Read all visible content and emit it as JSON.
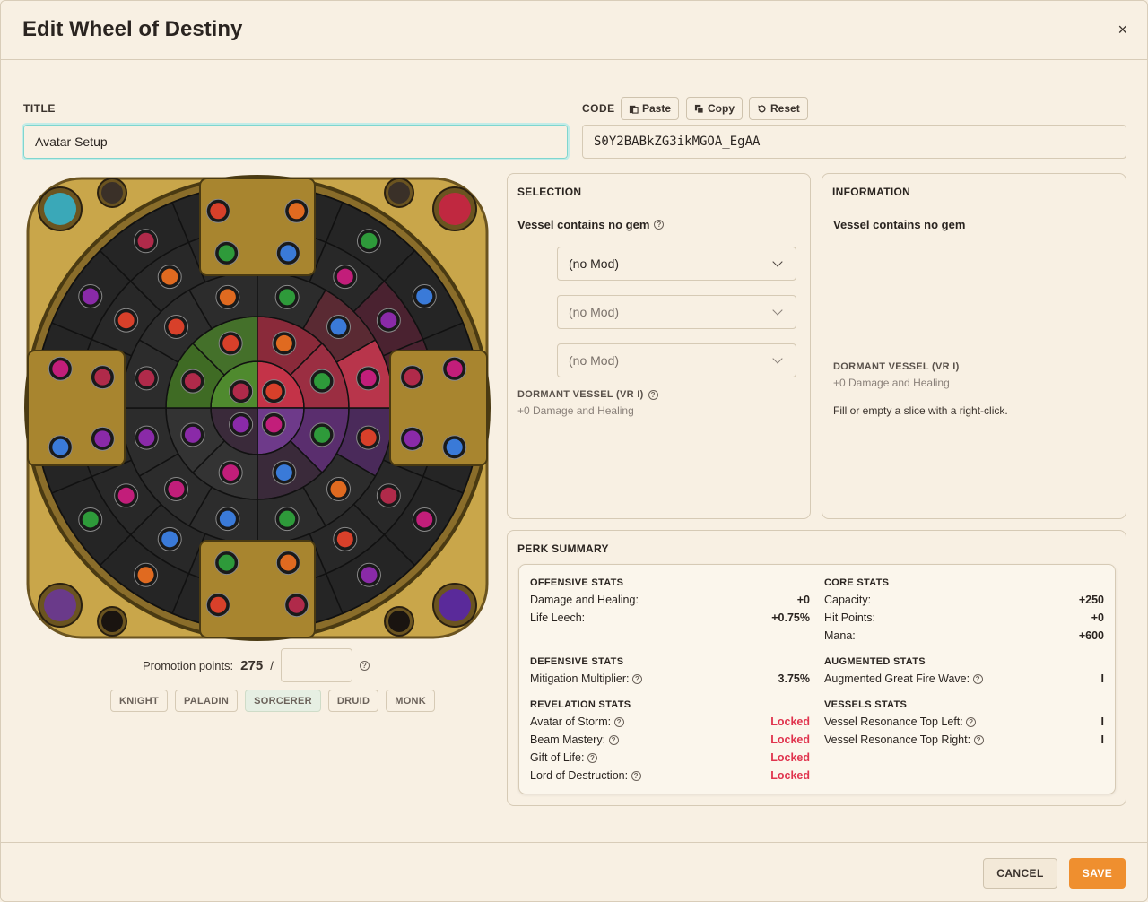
{
  "dialog": {
    "title": "Edit Wheel of Destiny",
    "close_icon": "×"
  },
  "form": {
    "title_label": "TITLE",
    "title_value": "Avatar Setup",
    "code_label": "CODE",
    "code_value": "S0Y2BABkZG3ikMGOA_EgAA",
    "paste_label": "Paste",
    "copy_label": "Copy",
    "reset_label": "Reset"
  },
  "wheel": {
    "promotion_label": "Promotion points:",
    "promotion_points": "275",
    "separator": "/",
    "promotion_input": "",
    "vocations": [
      "KNIGHT",
      "PALADIN",
      "SORCERER",
      "DRUID",
      "MONK"
    ],
    "active_vocation": "SORCERER",
    "colors": {
      "green": "#4f8a2e",
      "red": "#c43348",
      "purple": "#6e3a8a",
      "gold": "#c9a64a",
      "dark": "#2a2a2a"
    }
  },
  "selection": {
    "header": "SELECTION",
    "vessel_text": "Vessel contains no gem",
    "mods": [
      "(no Mod)",
      "(no Mod)",
      "(no Mod)"
    ],
    "dormant_label": "DORMANT VESSEL (VR I)",
    "dormant_value": "+0 Damage and Healing"
  },
  "information": {
    "header": "INFORMATION",
    "vessel_text": "Vessel contains no gem",
    "dormant_label": "DORMANT VESSEL (VR I)",
    "dormant_value": "+0 Damage and Healing",
    "hint": "Fill or empty a slice with a right-click."
  },
  "perk_summary": {
    "header": "PERK SUMMARY",
    "offensive": {
      "header": "OFFENSIVE STATS",
      "rows": [
        {
          "label": "Damage and Healing:",
          "value": "+0"
        },
        {
          "label": "Life Leech:",
          "value": "+0.75%"
        }
      ]
    },
    "core": {
      "header": "CORE STATS",
      "rows": [
        {
          "label": "Capacity:",
          "value": "+250"
        },
        {
          "label": "Hit Points:",
          "value": "+0"
        },
        {
          "label": "Mana:",
          "value": "+600"
        }
      ]
    },
    "defensive": {
      "header": "DEFENSIVE STATS",
      "rows": [
        {
          "label": "Mitigation Multiplier:",
          "value": "3.75%"
        }
      ]
    },
    "augmented": {
      "header": "AUGMENTED STATS",
      "rows": [
        {
          "label": "Augmented Great Fire Wave:",
          "value": "I"
        }
      ]
    },
    "revelation": {
      "header": "REVELATION STATS",
      "rows": [
        {
          "label": "Avatar of Storm:",
          "value": "Locked"
        },
        {
          "label": "Beam Mastery:",
          "value": "Locked"
        },
        {
          "label": "Gift of Life:",
          "value": "Locked"
        },
        {
          "label": "Lord of Destruction:",
          "value": "Locked"
        }
      ]
    },
    "vessels": {
      "header": "VESSELS STATS",
      "rows": [
        {
          "label": "Vessel Resonance Top Left:",
          "value": "I"
        },
        {
          "label": "Vessel Resonance Top Right:",
          "value": "I"
        }
      ]
    }
  },
  "footer": {
    "cancel_label": "CANCEL",
    "save_label": "SAVE"
  }
}
